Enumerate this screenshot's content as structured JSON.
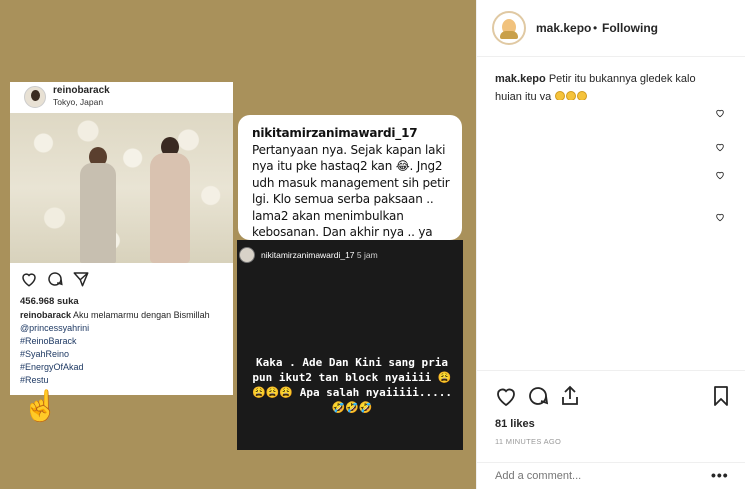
{
  "collage": {
    "card1": {
      "username": "reinobarack",
      "location": "Tokyo, Japan",
      "likes": "456.968 suka",
      "caption_user": "reinobarack",
      "caption_text": "Aku melamarmu dengan Bismillah",
      "tags": [
        "@princessyahrini",
        "#ReinoBarack",
        "#SyahReino",
        "#EnergyOfAkad",
        "#Restu"
      ]
    },
    "card2": {
      "username": "nikitamirzanimawardi_17",
      "text": "Pertanyaan nya. Sejak kapan laki nya itu  pke hastaq2 kan 😂. Jng2 udh masuk management sih petir lgi. Klo semua serba paksaan .. lama2 akan menimbulkan kebosanan. Dan akhir nya .. ya sudah lah....."
    },
    "card3": {
      "username": "nikitamirzanimawardi_17",
      "time": "5 jam",
      "text": "Kaka . Ade Dan  Kini sang pria pun ikut2 tan block nyaiiii 😩😩😩😩 Apa salah nyaiiiii.....🤣🤣🤣"
    }
  },
  "panel": {
    "username": "mak.kepo",
    "separator": "•",
    "follow_status": "Following",
    "caption_user": "mak.kepo",
    "caption_text": "Petir itu bukannya gledek kalo hujan itu ya",
    "likes": "81 likes",
    "time_ago": "11 MINUTES AGO",
    "comment_placeholder": "Add a comment...",
    "more": "•••"
  },
  "colors": {
    "collage_bg": "#a9915b",
    "text": "#262626",
    "muted": "#999999",
    "hashtag": "#1f3a64"
  }
}
